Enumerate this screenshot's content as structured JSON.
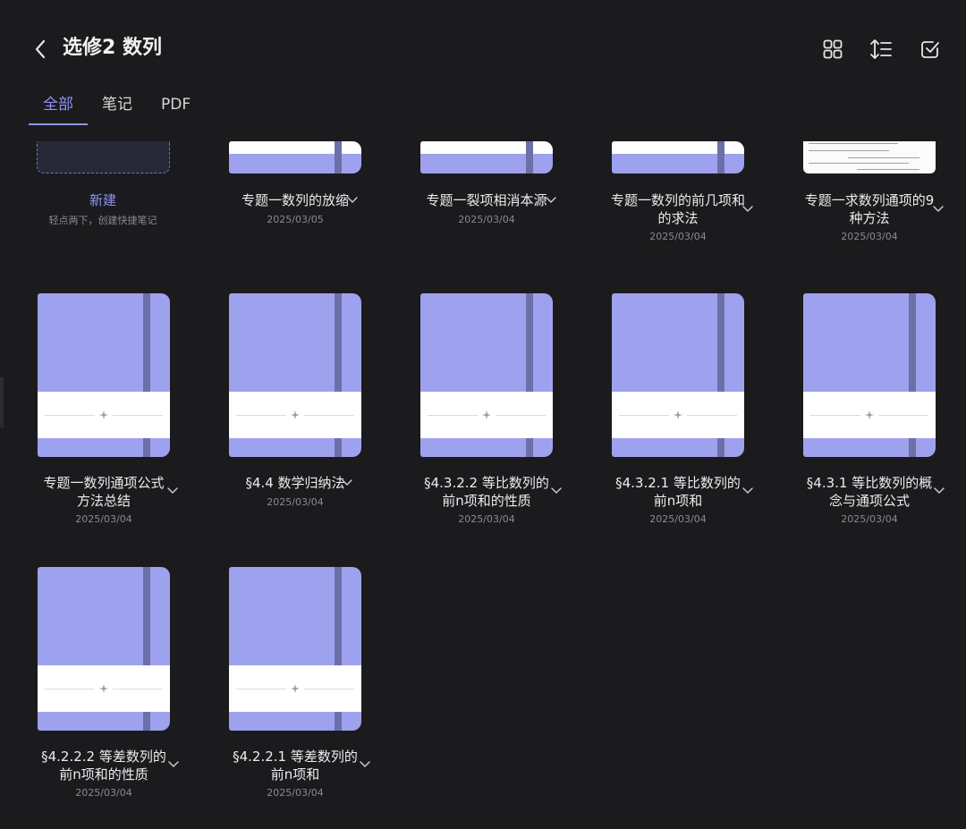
{
  "header": {
    "title": "选修2 数列",
    "back_icon": "chevron-left-icon",
    "actions": [
      "grid-view-icon",
      "sort-icon",
      "select-check-icon"
    ]
  },
  "tabs": [
    {
      "label": "全部",
      "active": true
    },
    {
      "label": "笔记",
      "active": false
    },
    {
      "label": "PDF",
      "active": false
    }
  ],
  "colors": {
    "background": "#1b1b1d",
    "accent": "#8f93f2",
    "cover": "#9ea2ee",
    "spine": "#6d6fa8"
  },
  "new_item": {
    "label": "新建",
    "hint": "轻点两下，创建快捷笔记"
  },
  "items": [
    {
      "name": "专题一数列的放缩",
      "date": "2025/03/05"
    },
    {
      "name": "专题一裂项相消本源",
      "date": "2025/03/04"
    },
    {
      "name": "专题一数列的前几项和的求法",
      "date": "2025/03/04"
    },
    {
      "name": "专题一求数列通项的9种方法",
      "date": "2025/03/04"
    },
    {
      "name": "专题一数列通项公式方法总结",
      "date": "2025/03/04"
    },
    {
      "name": "§4.4 数学归纳法",
      "date": "2025/03/04"
    },
    {
      "name": "§4.3.2.2 等比数列的前n项和的性质",
      "date": "2025/03/04"
    },
    {
      "name": "§4.3.2.1 等比数列的前n项和",
      "date": "2025/03/04"
    },
    {
      "name": "§4.3.1 等比数列的概念与通项公式",
      "date": "2025/03/04"
    },
    {
      "name": "§4.2.2.2 等差数列的前n项和的性质",
      "date": "2025/03/04"
    },
    {
      "name": "§4.2.2.1 等差数列的前n项和",
      "date": "2025/03/04"
    }
  ]
}
